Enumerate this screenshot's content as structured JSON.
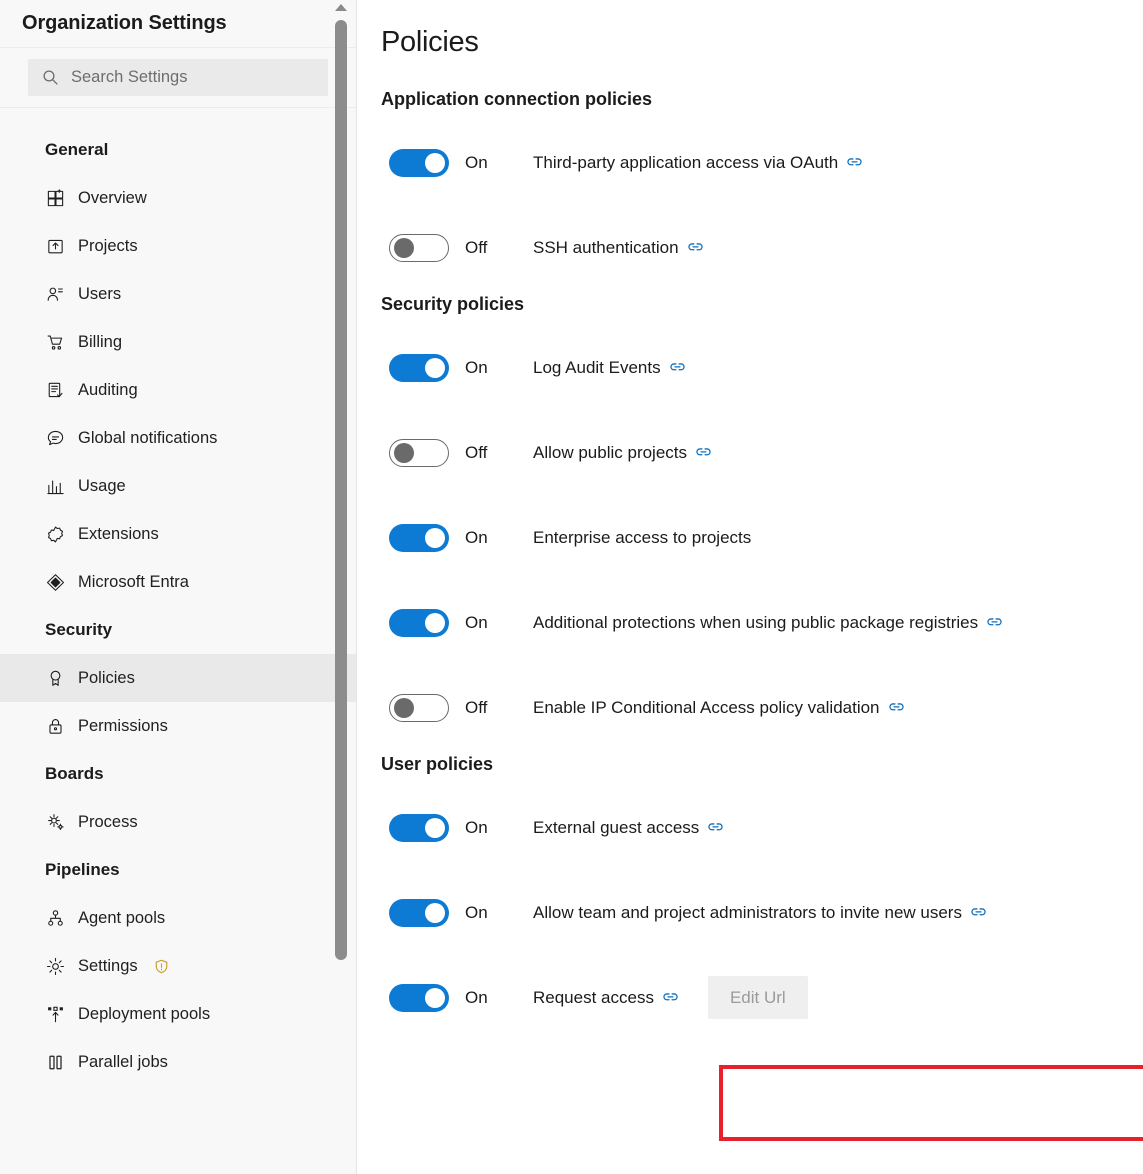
{
  "sidebar": {
    "title": "Organization Settings",
    "search": {
      "placeholder": "Search Settings",
      "value": "",
      "icon": "search-icon"
    },
    "groups": [
      {
        "title": "General",
        "items": [
          {
            "label": "Overview",
            "icon": "overview-icon",
            "selected": false
          },
          {
            "label": "Projects",
            "icon": "projects-icon",
            "selected": false
          },
          {
            "label": "Users",
            "icon": "users-icon",
            "selected": false
          },
          {
            "label": "Billing",
            "icon": "billing-cart-icon",
            "selected": false
          },
          {
            "label": "Auditing",
            "icon": "auditing-list-icon",
            "selected": false
          },
          {
            "label": "Global notifications",
            "icon": "notifications-chat-icon",
            "selected": false
          },
          {
            "label": "Usage",
            "icon": "usage-bar-chart-icon",
            "selected": false
          },
          {
            "label": "Extensions",
            "icon": "extensions-puzzle-icon",
            "selected": false
          },
          {
            "label": "Microsoft Entra",
            "icon": "microsoft-entra-icon",
            "selected": false
          }
        ]
      },
      {
        "title": "Security",
        "items": [
          {
            "label": "Policies",
            "icon": "policies-ribbon-icon",
            "selected": true
          },
          {
            "label": "Permissions",
            "icon": "permissions-lock-icon",
            "selected": false
          }
        ]
      },
      {
        "title": "Boards",
        "items": [
          {
            "label": "Process",
            "icon": "process-gear-icon",
            "selected": false
          }
        ]
      },
      {
        "title": "Pipelines",
        "items": [
          {
            "label": "Agent pools",
            "icon": "agent-pools-icon",
            "selected": false
          },
          {
            "label": "Settings",
            "icon": "settings-gear-icon",
            "selected": false,
            "badge": "warning-shield-icon"
          },
          {
            "label": "Deployment pools",
            "icon": "deployment-pools-icon",
            "selected": false
          },
          {
            "label": "Parallel jobs",
            "icon": "parallel-jobs-icon",
            "selected": false
          }
        ]
      }
    ]
  },
  "main": {
    "page_title": "Policies",
    "sections": [
      {
        "title": "Application connection policies",
        "policies": [
          {
            "state": "On",
            "on": true,
            "label": "Third-party application access via OAuth",
            "has_link": true,
            "button": null
          },
          {
            "state": "Off",
            "on": false,
            "label": "SSH authentication",
            "has_link": true,
            "button": null
          }
        ]
      },
      {
        "title": "Security policies",
        "policies": [
          {
            "state": "On",
            "on": true,
            "label": "Log Audit Events",
            "has_link": true,
            "button": null
          },
          {
            "state": "Off",
            "on": false,
            "label": "Allow public projects",
            "has_link": true,
            "button": null
          },
          {
            "state": "On",
            "on": true,
            "label": "Enterprise access to projects",
            "has_link": false,
            "button": null
          },
          {
            "state": "On",
            "on": true,
            "label": "Additional protections when using public package registries",
            "has_link": true,
            "button": null
          },
          {
            "state": "Off",
            "on": false,
            "label": "Enable IP Conditional Access policy validation",
            "has_link": true,
            "button": null
          }
        ]
      },
      {
        "title": "User policies",
        "policies": [
          {
            "state": "On",
            "on": true,
            "label": "External guest access",
            "has_link": true,
            "button": null
          },
          {
            "state": "On",
            "on": true,
            "label": "Allow team and project administrators to invite new users",
            "has_link": true,
            "button": null
          },
          {
            "state": "On",
            "on": true,
            "label": "Request access",
            "has_link": true,
            "button": "Edit Url",
            "highlighted": true
          }
        ]
      }
    ]
  },
  "colors": {
    "accent_blue": "#0d7bd4",
    "link_blue": "#0b6ebd",
    "highlight_red": "#e8202a",
    "sidebar_bg": "#f8f8f8",
    "selected_bg": "#e9e9e9",
    "warning_gold": "#c8a028",
    "button_bg": "#efefef",
    "button_text": "#9a9a9a"
  }
}
